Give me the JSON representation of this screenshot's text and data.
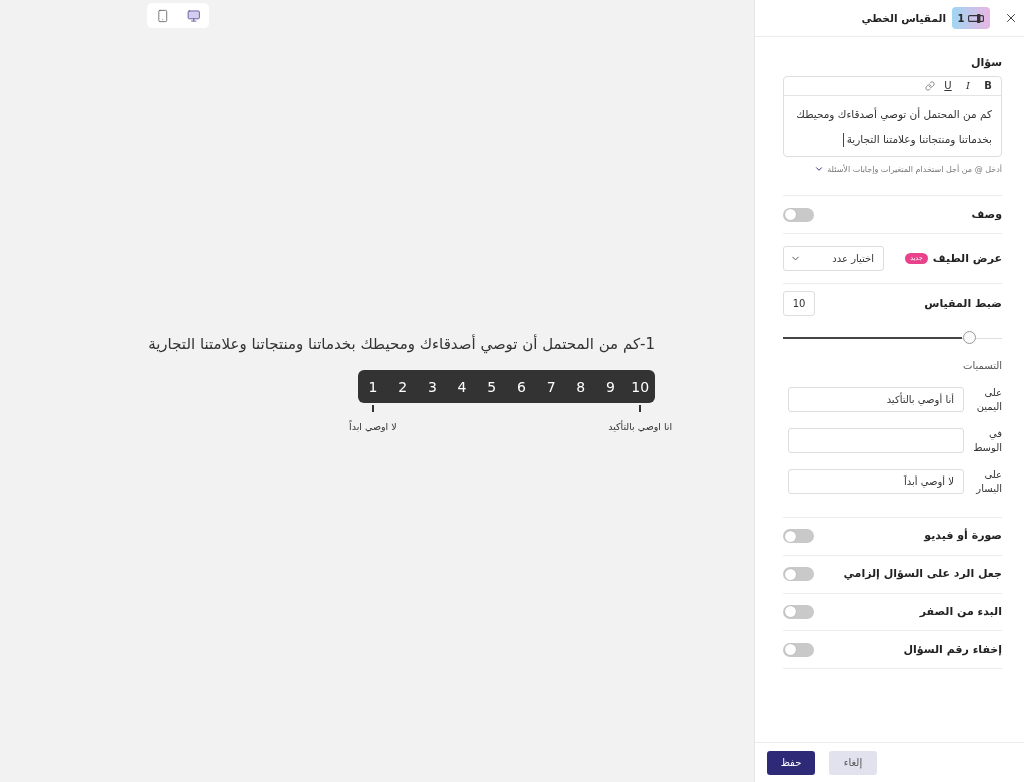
{
  "device_views": [
    {
      "kind": "mobile",
      "selected": false
    },
    {
      "kind": "desktop",
      "selected": true
    }
  ],
  "preview": {
    "question_number": "1-",
    "question": "كم من المحتمل أن توصي أصدقاءك ومحيطك بخدماتنا ومنتجاتنا وعلامتنا التجارية",
    "scale": [
      "10",
      "9",
      "8",
      "7",
      "6",
      "5",
      "4",
      "3",
      "2",
      "1"
    ],
    "right_label": "انا اوصي بالتأكيد",
    "left_label": "لا اوصي ابداً"
  },
  "panel": {
    "title": "المقياس الخطي",
    "type_number": "1",
    "question": {
      "label": "سؤال",
      "toolbar": [
        {
          "kind": "bold",
          "text": "B"
        },
        {
          "kind": "italic",
          "text": "I"
        },
        {
          "kind": "underline",
          "text": "U"
        },
        {
          "kind": "link"
        }
      ],
      "text": "كم من المحتمل أن توصي أصدقاءك ومحيطك بخدماتنا ومنتجاتنا وعلامتنا التجارية",
      "focused": true,
      "hint": "أدخل @ من أجل استخدام المتغيرات وإجابات الأسئلة"
    },
    "description": {
      "label": "وصف",
      "on": false
    },
    "spectrum": {
      "label": "عرض الطيف",
      "badge": "جديد",
      "dropdown": "اختيار عدد"
    },
    "scale": {
      "label": "ضبط المقياس",
      "value": "10",
      "level": 0.85
    },
    "labels": {
      "title": "التسميات",
      "fields": [
        {
          "label": "على اليمين",
          "value": "أنا أوصي بالتأكيد"
        },
        {
          "label": "في الوسط"
        },
        {
          "label": "على اليسار",
          "value": "لا أوصي أبداً"
        }
      ]
    },
    "toggles": [
      {
        "label": "صورة أو فيديو",
        "on": false
      },
      {
        "label": "جعل الرد على السؤال إلزامي",
        "on": false
      },
      {
        "label": "البدء من الصفر",
        "on": false
      },
      {
        "label": "إخفاء رقم السؤال",
        "on": false
      }
    ],
    "buttons": [
      {
        "kind": "secondary",
        "label": "إلغاء"
      },
      {
        "kind": "primary",
        "label": "حفظ"
      }
    ]
  }
}
